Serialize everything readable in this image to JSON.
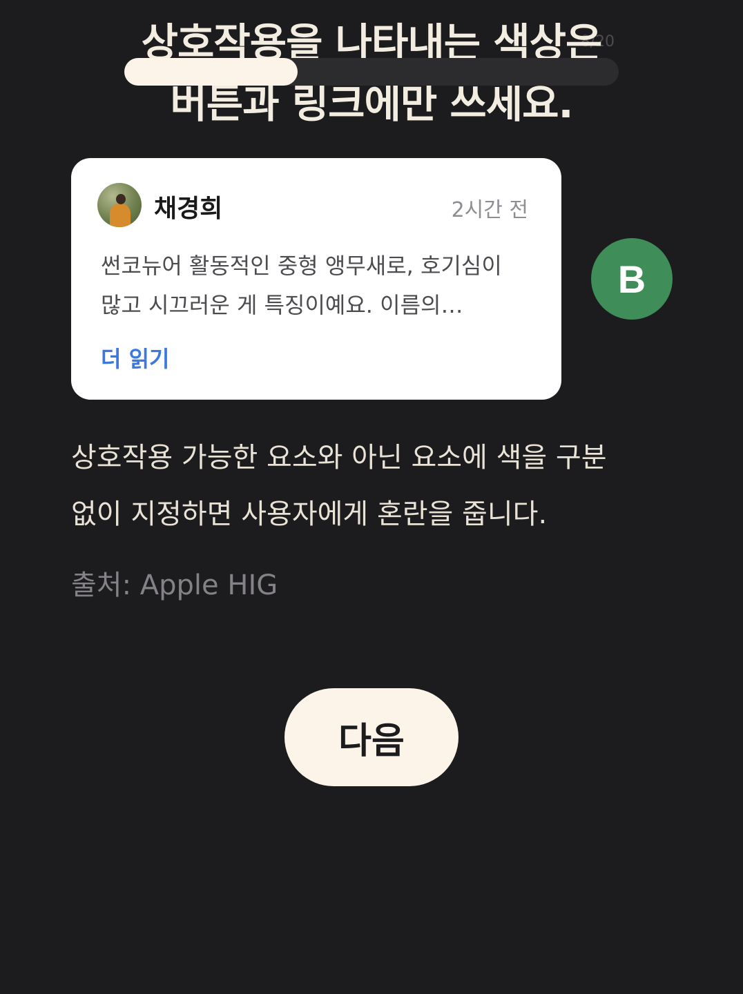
{
  "header": {
    "title": "상호작용을 나타내는 색상은\n버튼과 링크에만 쓰세요.",
    "counter": "8/20",
    "progress_fraction": 0.35
  },
  "card": {
    "author": "채경희",
    "time": "2시간 전",
    "excerpt": "썬코뉴어 활동적인 중형 앵무새로, 호기심이 많고 시끄러운 게 특징이예요. 이름의…",
    "read_more": "더 읽기"
  },
  "badge": {
    "letter": "B",
    "color": "#3f8d58"
  },
  "content": {
    "description": "상호작용 가능한 요소와 아닌 요소에 색을 구분 없이 지정하면 사용자에게 혼란을 줍니다.",
    "source": "출처: Apple HIG"
  },
  "actions": {
    "next_label": "다음"
  },
  "colors": {
    "background": "#1c1b1d",
    "accent_cream": "#fcf4e8",
    "link_blue": "#3b78e0"
  }
}
